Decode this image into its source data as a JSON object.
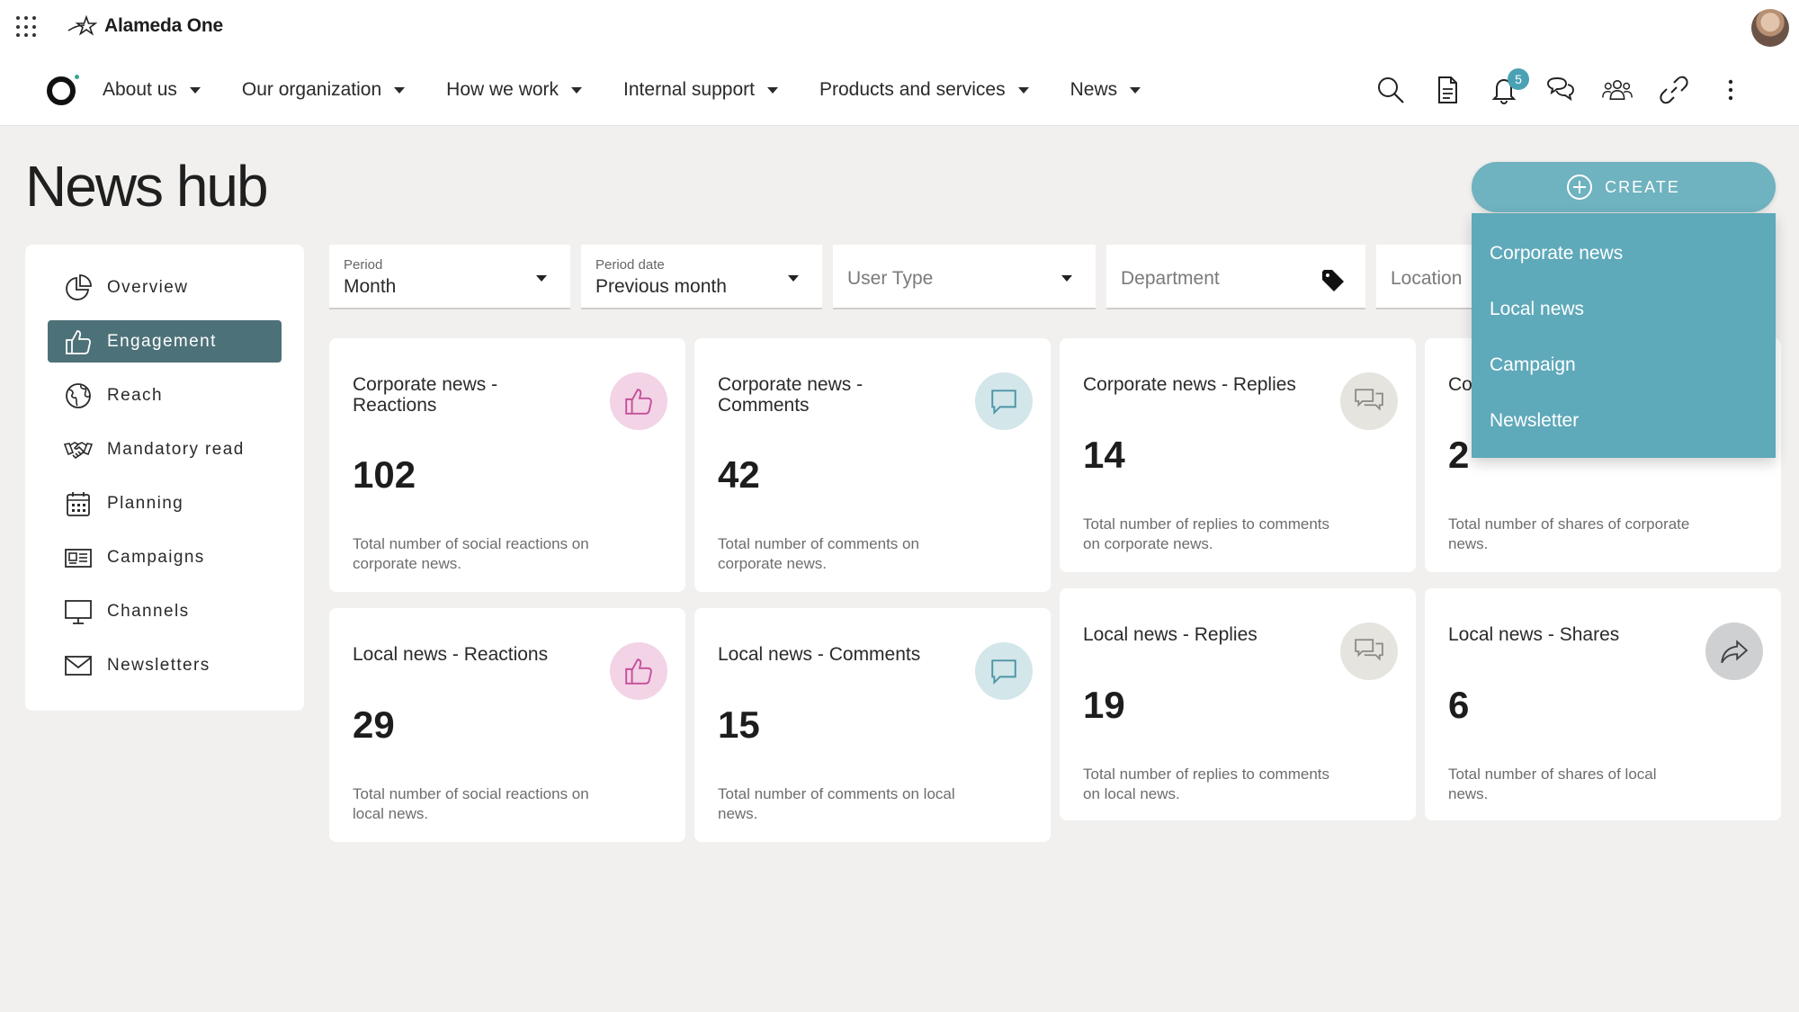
{
  "app": {
    "name": "Alameda One"
  },
  "nav": {
    "items": [
      {
        "label": "About us"
      },
      {
        "label": "Our organization"
      },
      {
        "label": "How we work"
      },
      {
        "label": "Internal support"
      },
      {
        "label": "Products and services"
      },
      {
        "label": "News"
      }
    ],
    "icons": [
      "search-icon",
      "document-icon",
      "bell-icon",
      "chat-icon",
      "people-icon",
      "link-icon",
      "more-vertical-icon"
    ],
    "notification_count": "5"
  },
  "page": {
    "title": "News hub"
  },
  "create": {
    "label": "CREATE",
    "menu": [
      "Corporate news",
      "Local news",
      "Campaign",
      "Newsletter"
    ]
  },
  "sidebar": {
    "items": [
      {
        "label": "Overview",
        "icon": "pie-chart-icon"
      },
      {
        "label": "Engagement",
        "icon": "thumbs-up-icon",
        "active": true
      },
      {
        "label": "Reach",
        "icon": "globe-icon"
      },
      {
        "label": "Mandatory read",
        "icon": "handshake-icon"
      },
      {
        "label": "Planning",
        "icon": "calendar-icon"
      },
      {
        "label": "Campaigns",
        "icon": "newspaper-icon"
      },
      {
        "label": "Channels",
        "icon": "monitor-icon"
      },
      {
        "label": "Newsletters",
        "icon": "envelope-icon"
      }
    ]
  },
  "filters": {
    "period": {
      "label": "Period",
      "value": "Month"
    },
    "period_date": {
      "label": "Period date",
      "value": "Previous month"
    },
    "user_type": {
      "placeholder": "User Type"
    },
    "department": {
      "placeholder": "Department"
    },
    "location": {
      "placeholder": "Location"
    }
  },
  "cards": [
    {
      "title": "Corporate news - Reactions",
      "value": "102",
      "desc": "Total number of social reactions on corporate news.",
      "icon": "thumbs-up-icon"
    },
    {
      "title": "Corporate news - Comments",
      "value": "42",
      "desc": "Total number of comments on corporate news.",
      "icon": "comment-icon"
    },
    {
      "title": "Corporate news - Replies",
      "value": "14",
      "desc": "Total number of replies to comments on corporate news.",
      "icon": "replies-icon"
    },
    {
      "title": "Co",
      "value": "2",
      "desc": "Total number of shares of corporate news.",
      "icon": "share-icon"
    },
    {
      "title": "Local news - Reactions",
      "value": "29",
      "desc": "Total number of social reactions on local news.",
      "icon": "thumbs-up-icon"
    },
    {
      "title": "Local news - Comments",
      "value": "15",
      "desc": "Total number of comments on local news.",
      "icon": "comment-icon"
    },
    {
      "title": "Local news - Replies",
      "value": "19",
      "desc": "Total number of replies to comments on local news.",
      "icon": "replies-icon"
    },
    {
      "title": "Local news - Shares",
      "value": "6",
      "desc": "Total number of shares of local news.",
      "icon": "share-icon"
    }
  ],
  "colors": {
    "accent": "#6fb2c0",
    "menu": "#5ea9ba",
    "active_nav": "#4d7178",
    "reactions_bg": "#f3d3e6",
    "reactions_fg": "#c4519a",
    "comments_bg": "#d3e6ea",
    "comments_fg": "#4d95a6",
    "replies_bg": "#e5e4df",
    "replies_fg": "#8b8b80",
    "shares_bg": "#cfd0d1"
  }
}
